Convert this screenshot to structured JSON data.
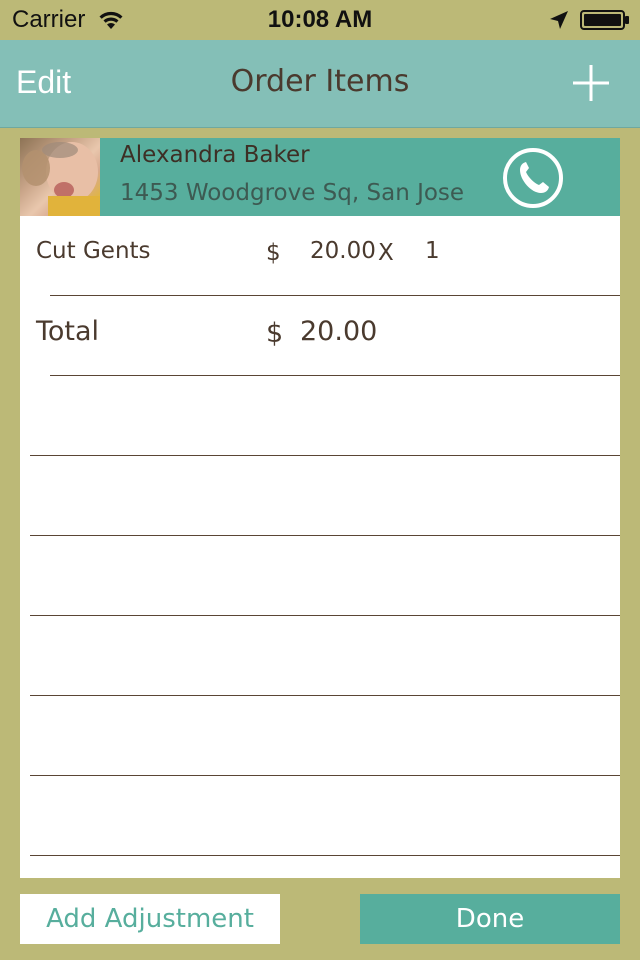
{
  "status_bar": {
    "carrier": "Carrier",
    "time": "10:08 AM"
  },
  "nav": {
    "edit_label": "Edit",
    "title": "Order Items",
    "add_icon": "plus-icon"
  },
  "customer": {
    "name": "Alexandra Baker",
    "address": "1453 Woodgrove Sq, San Jose",
    "call_icon": "phone-icon"
  },
  "items": [
    {
      "name": "Cut Gents",
      "currency": "$",
      "price": "20.00",
      "times": "X",
      "quantity": "1"
    }
  ],
  "total": {
    "label": "Total",
    "currency": "$",
    "value": "20.00"
  },
  "buttons": {
    "add_adjustment": "Add Adjustment",
    "done": "Done"
  },
  "colors": {
    "background": "#bcb977",
    "nav": "#84bfb7",
    "accent": "#57ae9d",
    "text": "#4a3a2e"
  }
}
